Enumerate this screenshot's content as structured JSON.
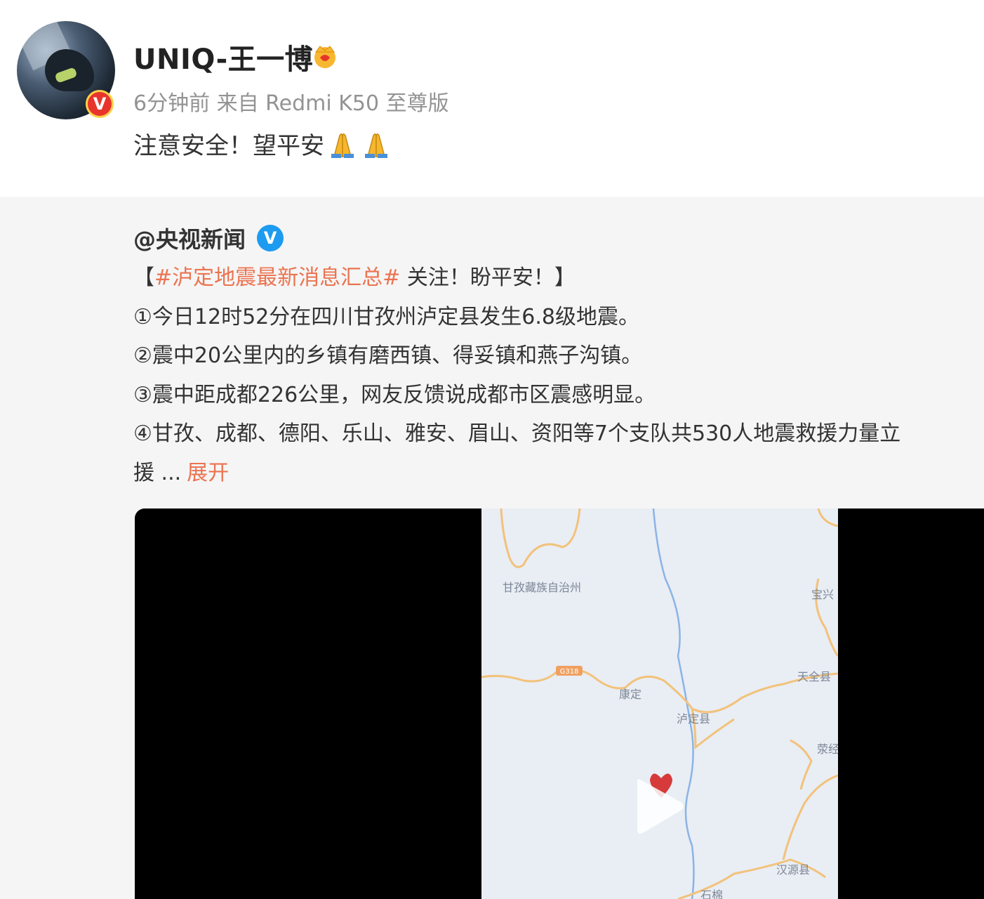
{
  "post": {
    "author": "UNIQ-王一博",
    "avatar_badge": "V",
    "meta": "6分钟前  来自 Redmi K50 至尊版",
    "text": "注意安全！望平安"
  },
  "repost": {
    "author": "@央视新闻",
    "verified_badge": "V",
    "open_bracket": "【",
    "hashtag": "#泸定地震最新消息汇总#",
    "headline_rest": " 关注！盼平安！】",
    "lines": [
      "①今日12时52分在四川甘孜州泸定县发生6.8级地震。",
      "②震中20公里内的乡镇有磨西镇、得妥镇和燕子沟镇。",
      "③震中距成都226公里，网友反馈说成都市区震感明显。",
      "④甘孜、成都、德阳、乐山、雅安、眉山、资阳等7个支队共530人地震救援力量立"
    ],
    "last_line": "援 ...",
    "expand_label": "展开"
  },
  "map_labels": {
    "prefecture": "甘孜藏族自治州",
    "county1": "泸定县",
    "county2": "康定",
    "town1": "天全县",
    "town2": "宝兴",
    "town3": "荥经",
    "town4": "汉源县",
    "town5": "石棉",
    "road": "G318"
  },
  "colors": {
    "accent": "#eb7350",
    "verified_blue": "#1d9bf0",
    "badge_red": "#e8352b"
  }
}
